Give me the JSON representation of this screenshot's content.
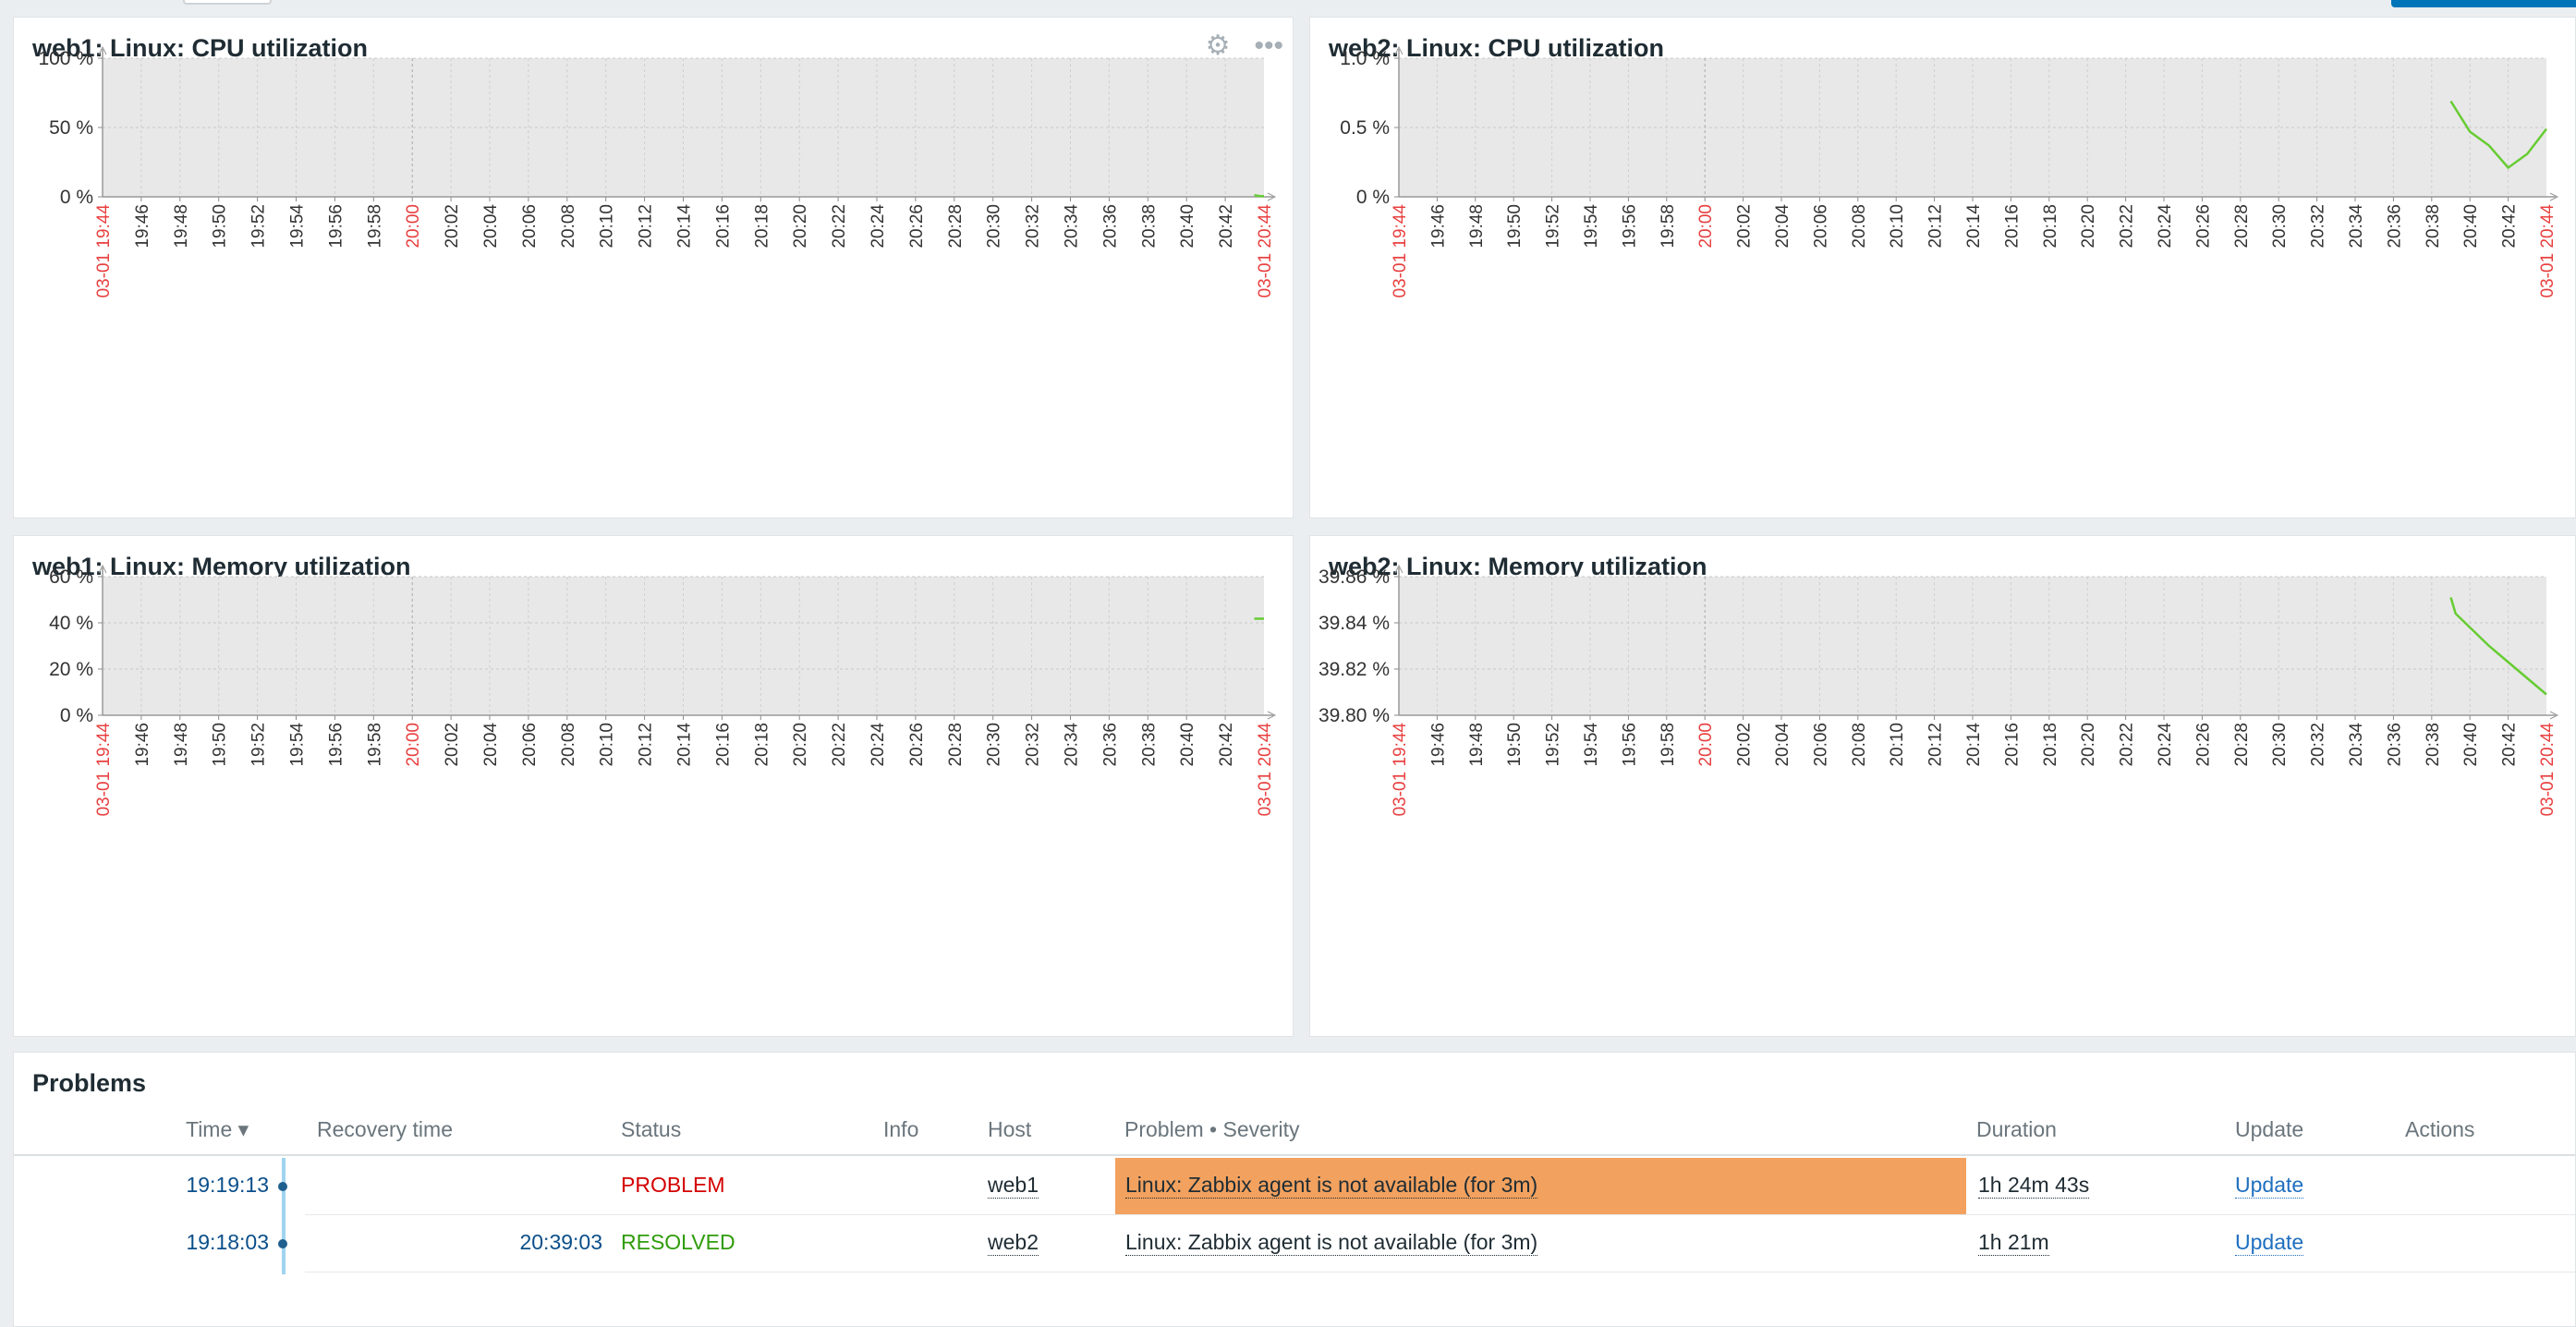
{
  "time_ticks": [
    "19:46",
    "19:48",
    "19:50",
    "19:52",
    "19:54",
    "19:56",
    "19:58",
    "20:00",
    "20:02",
    "20:04",
    "20:06",
    "20:08",
    "20:10",
    "20:12",
    "20:14",
    "20:16",
    "20:18",
    "20:20",
    "20:22",
    "20:24",
    "20:26",
    "20:28",
    "20:30",
    "20:32",
    "20:34",
    "20:36",
    "20:38",
    "20:40",
    "20:42"
  ],
  "x_start_label": "03-01 19:44",
  "x_end_label": "03-01 20:44",
  "highlight_tick": "20:00",
  "colors": {
    "series": "#66cc33",
    "plot_bg": "#e8e8e8",
    "axis_red": "#e84040",
    "axis_text": "#333333"
  },
  "widgets": [
    {
      "title": "web1: Linux: CPU utilization",
      "tools": [
        "gear-icon",
        "more-icon"
      ]
    },
    {
      "title": "web2: Linux: CPU utilization"
    },
    {
      "title": "web1: Linux: Memory utilization"
    },
    {
      "title": "web2: Linux: Memory utilization"
    }
  ],
  "chart_data": [
    {
      "type": "line",
      "title": "web1: Linux: CPU utilization",
      "ylim": [
        0,
        100
      ],
      "y_ticks": [
        "0 %",
        "50 %",
        "100 %"
      ],
      "y_tick_values": [
        0,
        50,
        100
      ],
      "series": [
        {
          "x": [
            "20:43:30",
            "20:43:45",
            "20:44:00"
          ],
          "values": [
            1.2,
            0.6,
            0.4
          ]
        }
      ]
    },
    {
      "type": "line",
      "title": "web2: Linux: CPU utilization",
      "ylim": [
        0,
        1.0
      ],
      "y_ticks": [
        "0 %",
        "0.5 %",
        "1.0 %"
      ],
      "y_tick_values": [
        0,
        0.5,
        1.0
      ],
      "series": [
        {
          "x": [
            "20:39:00",
            "20:40:00",
            "20:41:00",
            "20:42:00",
            "20:43:00",
            "20:44:00"
          ],
          "values": [
            0.69,
            0.47,
            0.37,
            0.21,
            0.31,
            0.49
          ]
        }
      ]
    },
    {
      "type": "line",
      "title": "web1: Linux: Memory utilization",
      "ylim": [
        0,
        60
      ],
      "y_ticks": [
        "0 %",
        "20 %",
        "40 %",
        "60 %"
      ],
      "y_tick_values": [
        0,
        20,
        40,
        60
      ],
      "series": [
        {
          "x": [
            "20:43:30",
            "20:44:00"
          ],
          "values": [
            41.8,
            41.8
          ]
        }
      ]
    },
    {
      "type": "line",
      "title": "web2: Linux: Memory utilization",
      "ylim": [
        39.8,
        39.86
      ],
      "y_ticks": [
        "39.80 %",
        "39.82 %",
        "39.84 %",
        "39.86 %"
      ],
      "y_tick_values": [
        39.8,
        39.82,
        39.84,
        39.86
      ],
      "series": [
        {
          "x": [
            "20:39:00",
            "20:39:15",
            "20:40:00",
            "20:41:00",
            "20:42:00",
            "20:43:00",
            "20:44:00"
          ],
          "values": [
            39.851,
            39.844,
            39.838,
            39.83,
            39.823,
            39.816,
            39.809
          ]
        }
      ]
    }
  ],
  "problems": {
    "title": "Problems",
    "columns": {
      "time": "Time ▾",
      "recovery": "Recovery time",
      "status": "Status",
      "info": "Info",
      "host": "Host",
      "problem": "Problem • Severity",
      "duration": "Duration",
      "update": "Update",
      "actions": "Actions"
    },
    "rows": [
      {
        "time": "19:19:13",
        "recovery": "",
        "status": "PROBLEM",
        "status_color": "#d40000",
        "host": "web1",
        "problem": "Linux: Zabbix agent is not available (for 3m)",
        "severity_color": "#f2a15f",
        "duration": "1h 24m 43s",
        "update": "Update"
      },
      {
        "time": "19:18:03",
        "recovery": "20:39:03",
        "status": "RESOLVED",
        "status_color": "#2f9c0a",
        "host": "web2",
        "problem": "Linux: Zabbix agent is not available (for 3m)",
        "severity_color": "",
        "duration": "1h 21m",
        "update": "Update"
      }
    ]
  }
}
